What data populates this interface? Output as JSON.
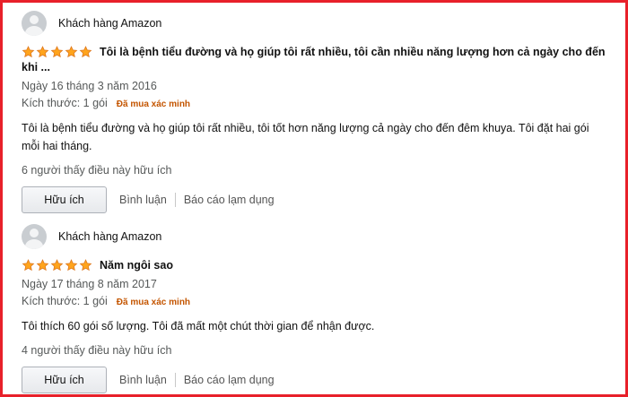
{
  "reviews": [
    {
      "author": "Khách hàng Amazon",
      "rating": 5,
      "title_line1": "Tôi là bệnh tiểu đường và họ giúp tôi rất nhiều, tôi cần nhiều năng lượng hơn cả ngày cho đến",
      "title_line2": "khi ...",
      "date": "Ngày 16 tháng 3 năm 2016",
      "size": "Kích thước: 1 gói",
      "verified": "Đã mua xác minh",
      "body": "Tôi là bệnh tiểu đường và họ giúp tôi rất nhiều, tôi tốt hơn năng lượng cả ngày cho đến đêm khuya. Tôi đặt hai gói mỗi hai tháng.",
      "helpful_count": "6 người thấy điều này hữu ích",
      "helpful_button": "Hữu ích",
      "comment_link": "Bình luận",
      "report_link": "Báo cáo lạm dụng"
    },
    {
      "author": "Khách hàng Amazon",
      "rating": 5,
      "title_line1": "Năm ngôi sao",
      "title_line2": "",
      "date": "Ngày 17 tháng 8 năm 2017",
      "size": "Kích thước: 1 gói",
      "verified": "Đã mua xác minh",
      "body": "Tôi thích 60 gói số lượng. Tôi đã mất một chút thời gian để nhận được.",
      "helpful_count": "4 người thấy điều này hữu ích",
      "helpful_button": "Hữu ích",
      "comment_link": "Bình luận",
      "report_link": "Báo cáo lạm dụng"
    }
  ],
  "colors": {
    "frame_border": "#e8202a",
    "star_fill": "#ffa41c",
    "star_stroke": "#de7921",
    "verified": "#c45500",
    "secondary_text": "#565959"
  }
}
